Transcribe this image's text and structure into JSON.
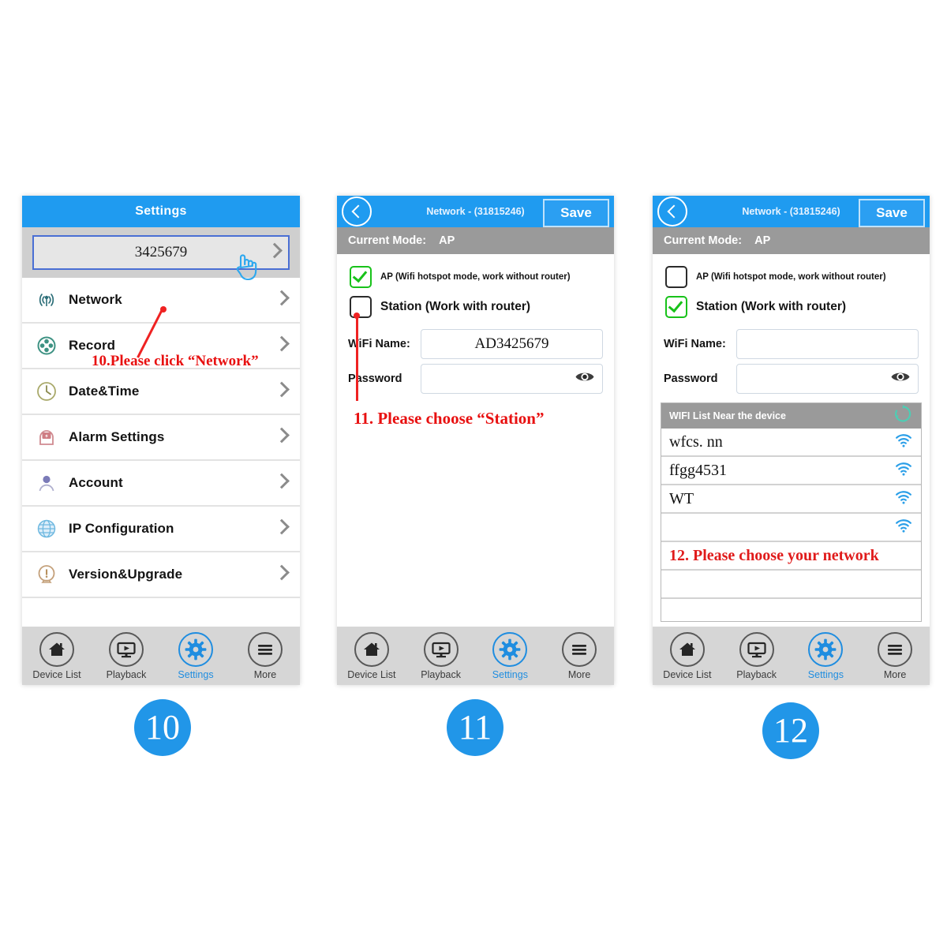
{
  "panel1": {
    "header_title": "Settings",
    "device": {
      "name": "3425679",
      "chevron_icon": "chevron-right-icon",
      "cursor_icon": "hand-pointer-icon"
    },
    "menu_items": [
      {
        "label": "Network",
        "icon": "wifi-signal-icon"
      },
      {
        "label": "Record",
        "icon": "record-reel-icon"
      },
      {
        "label": "Date&Time",
        "icon": "clock-icon"
      },
      {
        "label": "Alarm Settings",
        "icon": "alarm-bell-icon"
      },
      {
        "label": "Account",
        "icon": "user-icon"
      },
      {
        "label": "IP Configuration",
        "icon": "globe-icon"
      },
      {
        "label": "Version&Upgrade",
        "icon": "exclamation-icon"
      }
    ],
    "annotation": "10.Please click “Network”"
  },
  "panel2": {
    "header": {
      "title": "Network  - (31815246)",
      "save_label": "Save",
      "back_icon": "back-arrow-icon"
    },
    "mode": {
      "label": "Current Mode:",
      "value": "AP"
    },
    "options": [
      {
        "label": "AP (Wifi hotspot mode, work without router)",
        "checked": true,
        "size": "small"
      },
      {
        "label": "Station (Work with router)",
        "checked": false,
        "size": "large"
      }
    ],
    "fields": [
      {
        "label": "WiFi Name:",
        "value": "AD3425679",
        "has_eye": false
      },
      {
        "label": "Password",
        "value": "",
        "has_eye": true
      }
    ],
    "annotation": "11. Please choose “Station”"
  },
  "panel3": {
    "header": {
      "title": "Network  - (31815246)",
      "save_label": "Save",
      "back_icon": "back-arrow-icon"
    },
    "mode": {
      "label": "Current Mode:",
      "value": "AP"
    },
    "options": [
      {
        "label": "AP (Wifi hotspot mode, work without router)",
        "checked": false,
        "size": "small"
      },
      {
        "label": "Station (Work with router)",
        "checked": true,
        "size": "large"
      }
    ],
    "fields": [
      {
        "label": "WiFi Name:",
        "value": "",
        "has_eye": false
      },
      {
        "label": "Password",
        "value": "",
        "has_eye": true
      }
    ],
    "wifi_list": {
      "header": "WIFI List Near the device",
      "refresh_icon": "refresh-circle-icon",
      "rows": [
        {
          "name": "wfcs. nn",
          "has_wifi_icon": true,
          "is_note": false
        },
        {
          "name": "ffgg4531",
          "has_wifi_icon": true,
          "is_note": false
        },
        {
          "name": "WT",
          "has_wifi_icon": true,
          "is_note": false
        },
        {
          "name": "",
          "has_wifi_icon": true,
          "is_note": false
        },
        {
          "name": "12. Please choose your network",
          "has_wifi_icon": false,
          "is_note": true
        },
        {
          "name": "",
          "has_wifi_icon": false,
          "is_note": false
        },
        {
          "name": "",
          "has_wifi_icon": false,
          "is_note": false
        }
      ]
    }
  },
  "tabbar": {
    "items": [
      {
        "label": "Device List",
        "icon": "home-icon",
        "active": false
      },
      {
        "label": "Playback",
        "icon": "monitor-play-icon",
        "active": false
      },
      {
        "label": "Settings",
        "icon": "gear-icon",
        "active": true
      },
      {
        "label": "More",
        "icon": "hamburger-icon",
        "active": false
      }
    ]
  },
  "badges": {
    "step10": "10",
    "step11": "11",
    "step12": "12"
  },
  "colors": {
    "header_blue": "#1f9bf0",
    "accent_blue": "#2196e8",
    "mode_gray": "#9a9a9a",
    "annotation_red": "#e81010",
    "check_green": "#18c21a"
  }
}
